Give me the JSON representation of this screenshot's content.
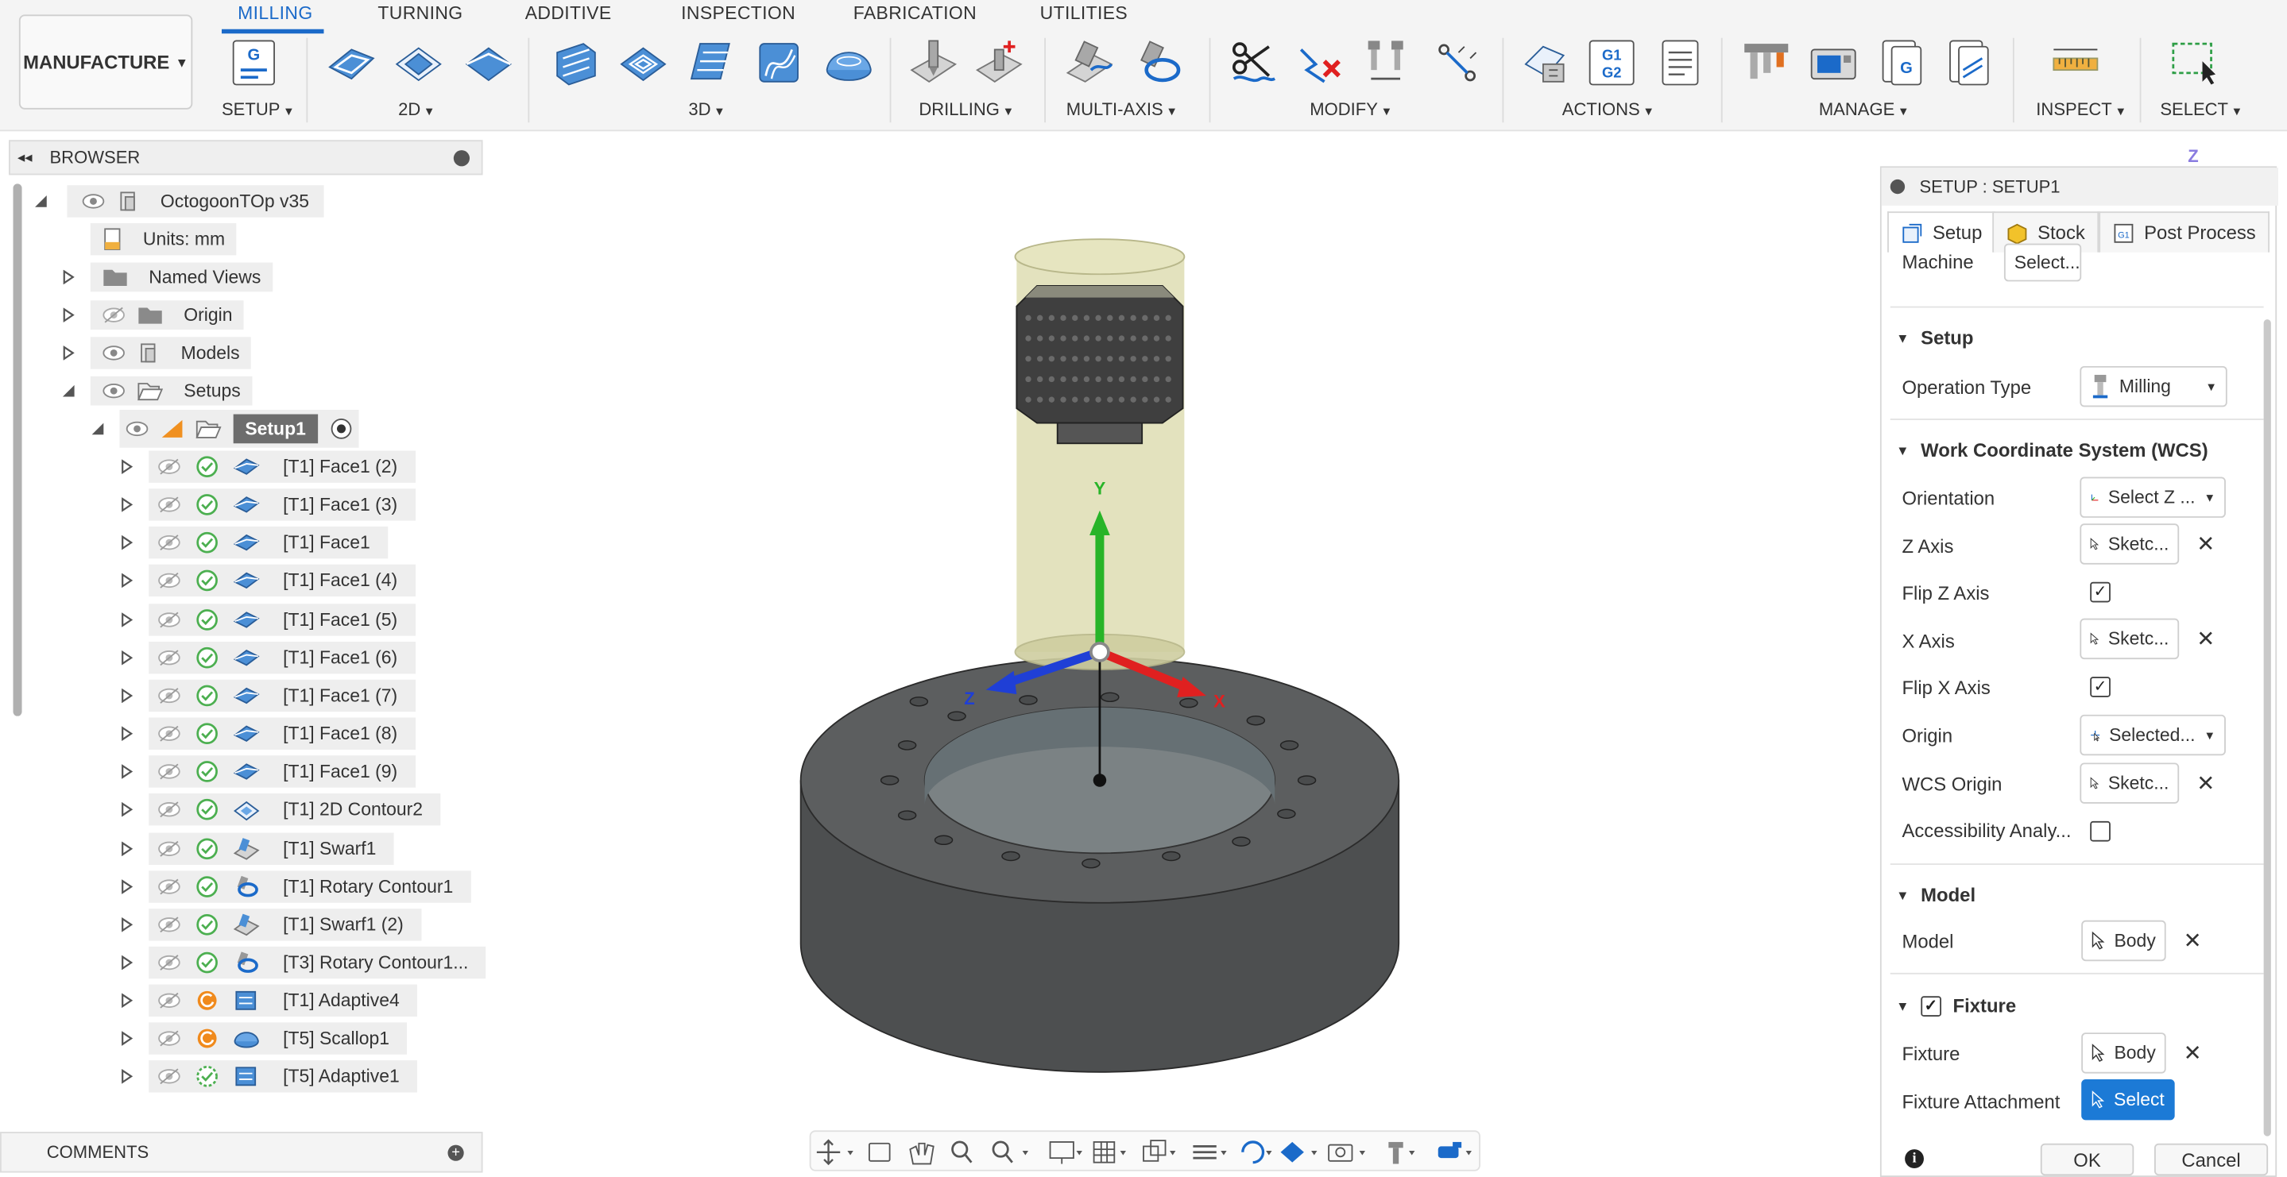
{
  "workspace": {
    "label": "MANUFACTURE"
  },
  "tabs": [
    "MILLING",
    "TURNING",
    "ADDITIVE",
    "INSPECTION",
    "FABRICATION",
    "UTILITIES"
  ],
  "toolbar_groups": [
    "SETUP",
    "2D",
    "3D",
    "DRILLING",
    "MULTI-AXIS",
    "MODIFY",
    "ACTIONS",
    "MANAGE",
    "INSPECT",
    "SELECT"
  ],
  "toolbar_icons": {
    "g1g2": "G1\nG2",
    "g": "G"
  },
  "browser": {
    "title": "BROWSER",
    "root": "OctogoonTOp v35",
    "units": "Units: mm",
    "named_views": "Named Views",
    "origin": "Origin",
    "models": "Models",
    "setups": "Setups",
    "setup1": "Setup1",
    "ops": [
      {
        "label": "[T1] Face1 (2)",
        "status": "ok",
        "icon": "face"
      },
      {
        "label": "[T1] Face1 (3)",
        "status": "ok",
        "icon": "face"
      },
      {
        "label": "[T1] Face1",
        "status": "ok",
        "icon": "face"
      },
      {
        "label": "[T1] Face1 (4)",
        "status": "ok",
        "icon": "face"
      },
      {
        "label": "[T1] Face1 (5)",
        "status": "ok",
        "icon": "face"
      },
      {
        "label": "[T1] Face1 (6)",
        "status": "ok",
        "icon": "face"
      },
      {
        "label": "[T1] Face1 (7)",
        "status": "ok",
        "icon": "face"
      },
      {
        "label": "[T1] Face1 (8)",
        "status": "ok",
        "icon": "face"
      },
      {
        "label": "[T1] Face1 (9)",
        "status": "ok",
        "icon": "face"
      },
      {
        "label": "[T1] 2D Contour2",
        "status": "ok",
        "icon": "contour"
      },
      {
        "label": "[T1] Swarf1",
        "status": "ok",
        "icon": "swarf"
      },
      {
        "label": "[T1] Rotary Contour1",
        "status": "ok",
        "icon": "rotary"
      },
      {
        "label": "[T1] Swarf1 (2)",
        "status": "ok",
        "icon": "swarf"
      },
      {
        "label": "[T3] Rotary Contour1...",
        "status": "ok",
        "icon": "rotary"
      },
      {
        "label": "[T1] Adaptive4",
        "status": "pending",
        "icon": "adaptive"
      },
      {
        "label": "[T5] Scallop1",
        "status": "pending",
        "icon": "scallop"
      },
      {
        "label": "[T5] Adaptive1",
        "status": "dashed",
        "icon": "adaptive"
      }
    ]
  },
  "comments": {
    "label": "COMMENTS"
  },
  "viewport": {
    "axis_y": "Y",
    "axis_x": "X",
    "axis_z": "Z",
    "viewcube_z": "Z"
  },
  "panel": {
    "title": "SETUP : SETUP1",
    "tabs": [
      "Setup",
      "Stock",
      "Post Process"
    ],
    "machine_label": "Machine",
    "machine_value": "Select...",
    "section_setup": "Setup",
    "operation_type_label": "Operation Type",
    "operation_type_value": "Milling",
    "section_wcs": "Work Coordinate System (WCS)",
    "orientation_label": "Orientation",
    "orientation_value": "Select Z ...",
    "z_axis_label": "Z Axis",
    "z_axis_value": "Sketc...",
    "flip_z_label": "Flip Z Axis",
    "flip_z_checked": true,
    "x_axis_label": "X Axis",
    "x_axis_value": "Sketc...",
    "flip_x_label": "Flip X Axis",
    "flip_x_checked": true,
    "origin_label": "Origin",
    "origin_value": "Selected...",
    "wcs_origin_label": "WCS Origin",
    "wcs_origin_value": "Sketc...",
    "accessibility_label": "Accessibility Analy...",
    "accessibility_checked": false,
    "section_model": "Model",
    "model_label": "Model",
    "model_value": "Body",
    "section_fixture": "Fixture",
    "fixture_checked": true,
    "fixture_label": "Fixture",
    "fixture_value": "Body",
    "fixture_attachment_label": "Fixture Attachment",
    "fixture_attachment_value": "Select",
    "ok": "OK",
    "cancel": "Cancel"
  },
  "colors": {
    "accent": "#1b6ac9",
    "selected_blue": "#1c7ad6",
    "ok_green": "#4caf50",
    "pending_orange": "#f08a1c"
  }
}
